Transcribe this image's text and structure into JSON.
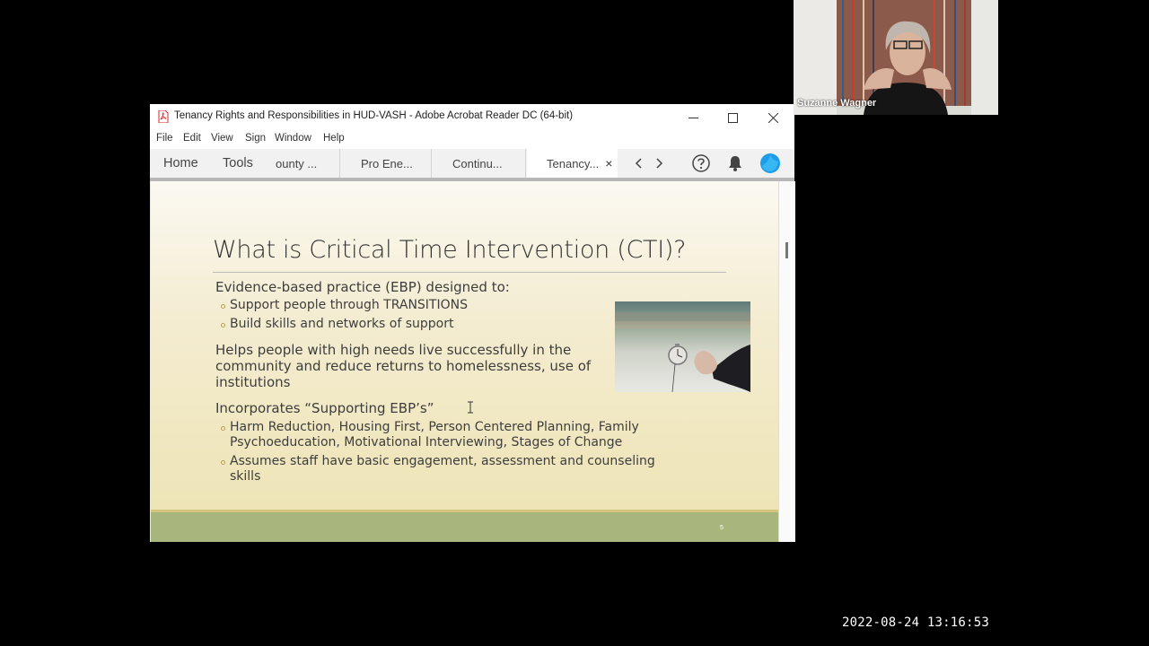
{
  "window": {
    "title": "Tenancy Rights and Responsibilities in HUD-VASH - Adobe Acrobat Reader DC (64-bit)",
    "icon": "acrobat-pdf-icon"
  },
  "menu": [
    "File",
    "Edit",
    "View",
    "Sign",
    "Window",
    "Help"
  ],
  "nav": {
    "home": "Home",
    "tools": "Tools"
  },
  "tabs": [
    {
      "label": "ounty ..."
    },
    {
      "label": "Pro Ene..."
    },
    {
      "label": "Continu..."
    },
    {
      "label": "Tenancy...",
      "close": "×"
    }
  ],
  "toolbar_icons": [
    "chevron-left-icon",
    "chevron-right-icon",
    "help-icon",
    "bell-icon",
    "profile-icon"
  ],
  "slide": {
    "title": "What is Critical Time Intervention (CTI)?",
    "intro": "Evidence-based practice (EBP) designed to:",
    "intro_bullets": [
      "Support people through TRANSITIONS",
      "Build skills and networks of support"
    ],
    "helps_line1": "Helps people with high needs live successfully in the",
    "helps_line2": "community and reduce returns to homelessness, use of",
    "helps_line3": "institutions",
    "incorporates": "Incorporates “Supporting EBP’s”",
    "b1_line1": "Harm Reduction, Housing First, Person Centered Planning, Family",
    "b1_line2": "Psychoeducation, Motivational Interviewing, Stages of Change",
    "b2_line1": "Assumes staff have basic engagement, assessment and counseling",
    "b2_line2": "skills",
    "page_number": "5"
  },
  "participant": {
    "name": "Suzanne Wagner"
  },
  "timestamp": "2022-08-24 13:16:53",
  "colors": {
    "accent": "#1e9be9",
    "slide_footer": "#a8b57c",
    "pdf_red": "#d8232a"
  }
}
